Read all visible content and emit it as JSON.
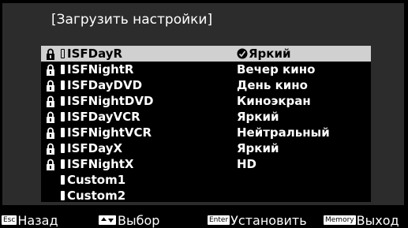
{
  "window": {
    "title": "[Загрузить настройки]"
  },
  "memory_list": {
    "rows": [
      {
        "name": "ISFDayR",
        "mode": "Яркий",
        "locked": true,
        "selected": true
      },
      {
        "name": "ISFNightR",
        "mode": "Вечер кино",
        "locked": true
      },
      {
        "name": "ISFDayDVD",
        "mode": "День кино",
        "locked": true
      },
      {
        "name": "ISFNightDVD",
        "mode": "Киноэкран",
        "locked": true
      },
      {
        "name": "ISFDayVCR",
        "mode": "Яркий",
        "locked": true
      },
      {
        "name": "ISFNightVCR",
        "mode": "Нейтральный",
        "locked": true
      },
      {
        "name": "ISFDayX",
        "mode": "Яркий",
        "locked": true
      },
      {
        "name": "ISFNightX",
        "mode": "HD",
        "locked": true
      },
      {
        "name": "Custom1",
        "mode": "",
        "locked": false
      },
      {
        "name": "Custom2",
        "mode": "",
        "locked": false
      }
    ]
  },
  "footer": {
    "back_key": "Esc",
    "back_label": "Назад",
    "select_label": "Выбор",
    "set_key": "Enter",
    "set_label": "Установить",
    "exit_key": "Memory",
    "exit_label": "Выход"
  },
  "icons": {
    "lock": "lock-icon",
    "memory": "memory-slot-icon",
    "current_mode": "current-mode-icon",
    "updown": "up-down-arrow-icon"
  }
}
